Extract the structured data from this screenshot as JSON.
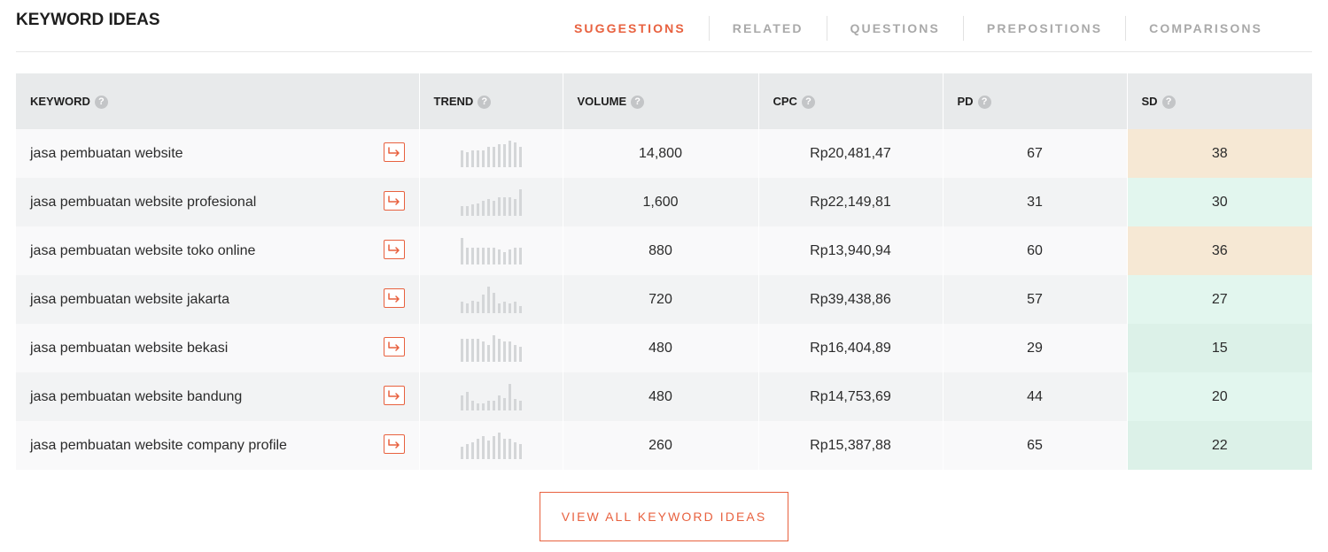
{
  "header": {
    "title": "KEYWORD IDEAS",
    "tabs": [
      {
        "label": "SUGGESTIONS",
        "active": true
      },
      {
        "label": "RELATED",
        "active": false
      },
      {
        "label": "QUESTIONS",
        "active": false
      },
      {
        "label": "PREPOSITIONS",
        "active": false
      },
      {
        "label": "COMPARISONS",
        "active": false
      }
    ]
  },
  "colors": {
    "accent": "#e8613f",
    "sd_medium": "#f6e8d4",
    "sd_easy": "#e2f6ee",
    "sd_easier": "#dcf1e8"
  },
  "table": {
    "columns": [
      "KEYWORD",
      "TREND",
      "VOLUME",
      "CPC",
      "PD",
      "SD"
    ],
    "help_icon": "?",
    "rows": [
      {
        "keyword": "jasa pembuatan website",
        "volume": "14,800",
        "cpc": "Rp20,481,47",
        "pd": "67",
        "sd": "38",
        "sd_color": "#f6e8d4",
        "trend": [
          0.62,
          0.55,
          0.62,
          0.62,
          0.62,
          0.76,
          0.76,
          0.86,
          0.86,
          1.0,
          0.93,
          0.76
        ]
      },
      {
        "keyword": "jasa pembuatan website profesional",
        "volume": "1,600",
        "cpc": "Rp22,149,81",
        "pd": "31",
        "sd": "30",
        "sd_color": "#e2f6ee",
        "trend": [
          0.35,
          0.35,
          0.42,
          0.48,
          0.55,
          0.62,
          0.55,
          0.7,
          0.7,
          0.7,
          0.62,
          1.0
        ]
      },
      {
        "keyword": "jasa pembuatan website toko online",
        "volume": "880",
        "cpc": "Rp13,940,94",
        "pd": "60",
        "sd": "36",
        "sd_color": "#f6e8d4",
        "trend": [
          1.0,
          0.62,
          0.62,
          0.62,
          0.62,
          0.62,
          0.62,
          0.55,
          0.48,
          0.55,
          0.62,
          0.62
        ]
      },
      {
        "keyword": "jasa pembuatan website jakarta",
        "volume": "720",
        "cpc": "Rp39,438,86",
        "pd": "57",
        "sd": "27",
        "sd_color": "#e2f6ee",
        "trend": [
          0.42,
          0.35,
          0.48,
          0.42,
          0.7,
          1.0,
          0.76,
          0.35,
          0.42,
          0.35,
          0.42,
          0.28
        ]
      },
      {
        "keyword": "jasa pembuatan website bekasi",
        "volume": "480",
        "cpc": "Rp16,404,89",
        "pd": "29",
        "sd": "15",
        "sd_color": "#dcf1e8",
        "trend": [
          0.86,
          0.86,
          0.86,
          0.86,
          0.76,
          0.62,
          1.0,
          0.86,
          0.76,
          0.76,
          0.62,
          0.55
        ]
      },
      {
        "keyword": "jasa pembuatan website bandung",
        "volume": "480",
        "cpc": "Rp14,753,69",
        "pd": "44",
        "sd": "20",
        "sd_color": "#e2f6ee",
        "trend": [
          0.55,
          0.7,
          0.35,
          0.28,
          0.28,
          0.35,
          0.35,
          0.55,
          0.48,
          1.0,
          0.42,
          0.35
        ]
      },
      {
        "keyword": "jasa pembuatan website company profile",
        "volume": "260",
        "cpc": "Rp15,387,88",
        "pd": "65",
        "sd": "22",
        "sd_color": "#dcf1e8",
        "trend": [
          0.48,
          0.55,
          0.62,
          0.76,
          0.86,
          0.7,
          0.86,
          1.0,
          0.76,
          0.76,
          0.62,
          0.55
        ]
      }
    ]
  },
  "view_all_label": "VIEW ALL KEYWORD IDEAS"
}
